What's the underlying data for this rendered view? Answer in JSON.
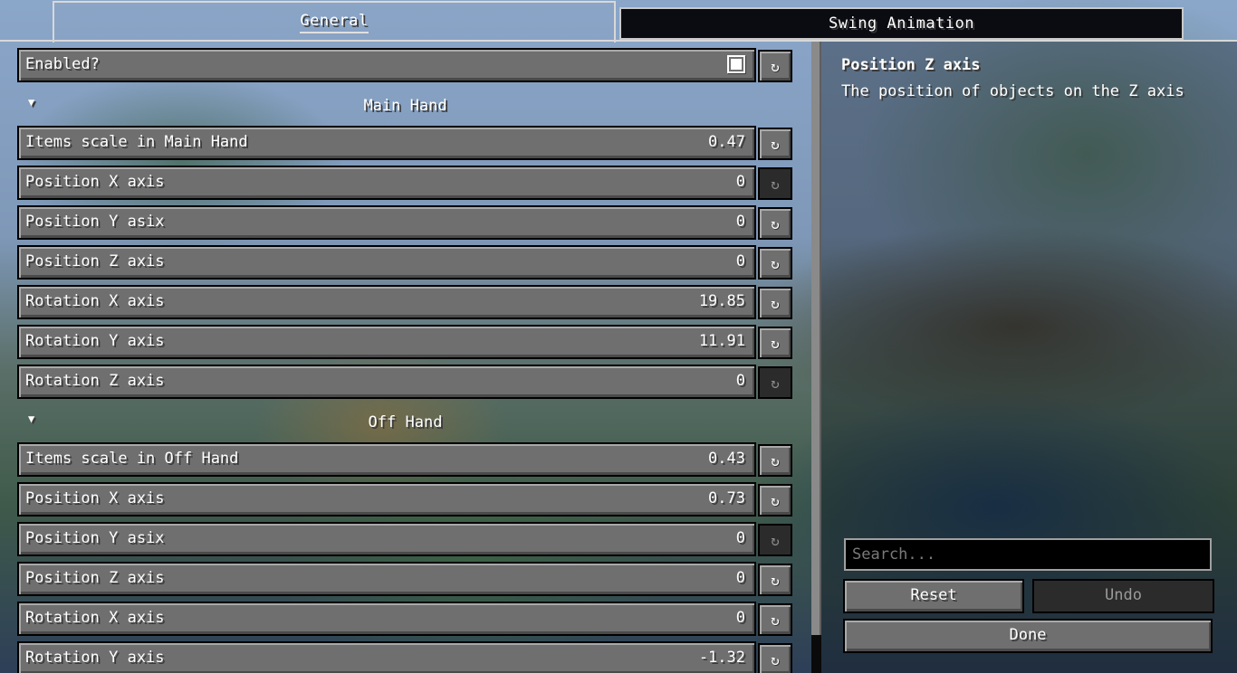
{
  "tabs": [
    {
      "label": "General",
      "active": true
    },
    {
      "label": "Swing Animation",
      "active": false
    }
  ],
  "enabled_row": {
    "label": "Enabled?",
    "checked": true
  },
  "sections": [
    {
      "title": "Main Hand",
      "rows": [
        {
          "label": "Items scale in Main Hand",
          "value": "0.47",
          "reset_enabled": true
        },
        {
          "label": "Position X axis",
          "value": "0",
          "reset_enabled": false
        },
        {
          "label": "Position Y asix",
          "value": "0",
          "reset_enabled": true
        },
        {
          "label": "Position Z axis",
          "value": "0",
          "reset_enabled": true
        },
        {
          "label": "Rotation X axis",
          "value": "19.85",
          "reset_enabled": true
        },
        {
          "label": "Rotation Y axis",
          "value": "11.91",
          "reset_enabled": true
        },
        {
          "label": "Rotation Z axis",
          "value": "0",
          "reset_enabled": false
        }
      ]
    },
    {
      "title": "Off Hand",
      "rows": [
        {
          "label": "Items scale in Off Hand",
          "value": "0.43",
          "reset_enabled": true
        },
        {
          "label": "Position X axis",
          "value": "0.73",
          "reset_enabled": true
        },
        {
          "label": "Position Y asix",
          "value": "0",
          "reset_enabled": false
        },
        {
          "label": "Position Z axis",
          "value": "0",
          "reset_enabled": true
        },
        {
          "label": "Rotation X axis",
          "value": "0",
          "reset_enabled": true
        },
        {
          "label": "Rotation Y axis",
          "value": "-1.32",
          "reset_enabled": true
        }
      ]
    }
  ],
  "reset_glyph": "↻",
  "collapse_glyph": "▼",
  "info": {
    "title": "Position Z axis",
    "description": "The position of objects on the Z axis"
  },
  "search": {
    "placeholder": "Search..."
  },
  "buttons": {
    "reset": "Reset",
    "undo": "Undo",
    "done": "Done"
  }
}
